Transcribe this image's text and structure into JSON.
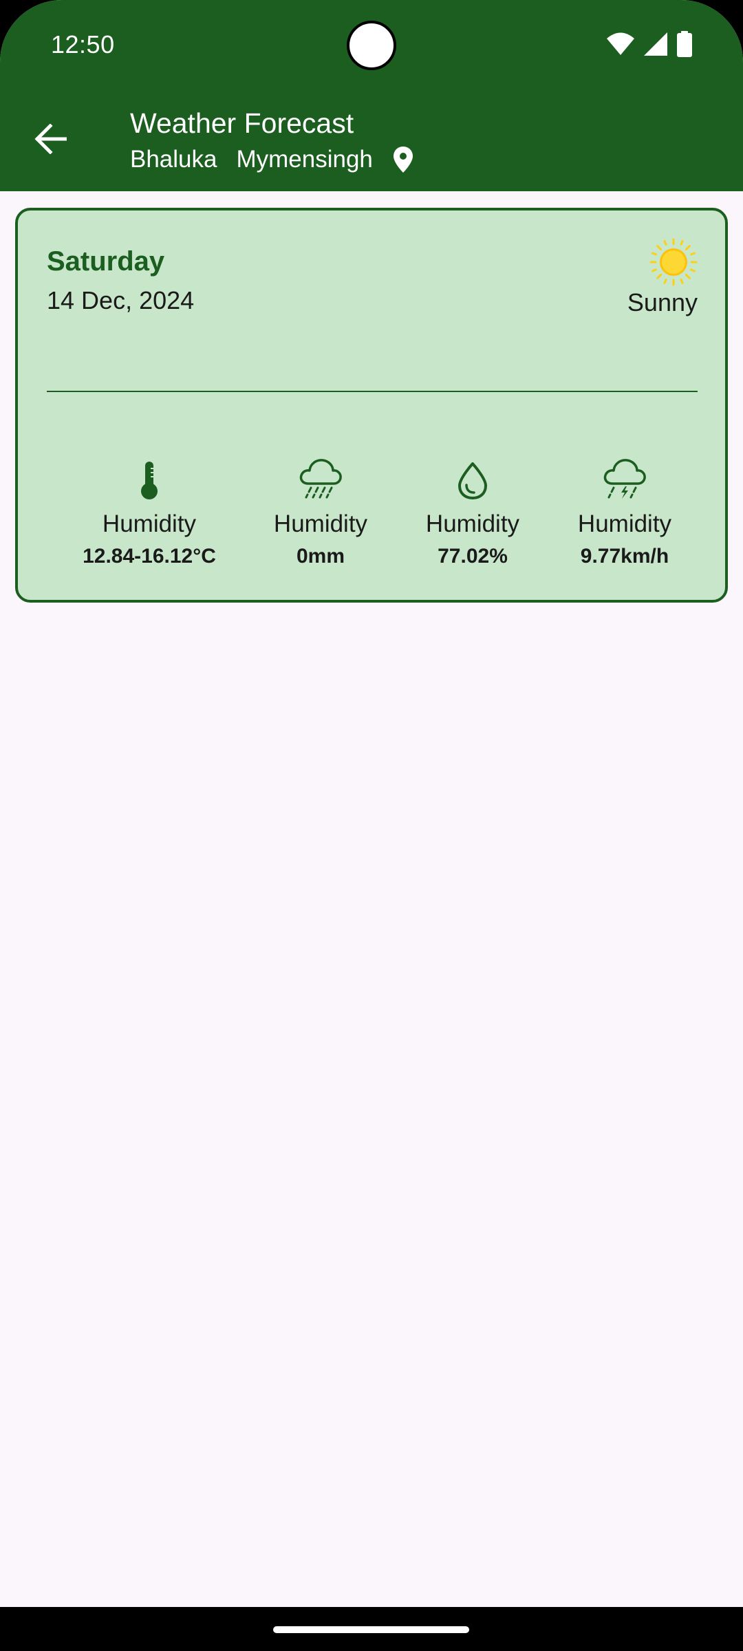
{
  "status_bar": {
    "time": "12:50",
    "icons": [
      "wifi-icon",
      "cellular-signal-icon",
      "battery-icon"
    ]
  },
  "toolbar": {
    "title": "Weather Forecast",
    "location_parts": [
      "Bhaluka",
      "Mymensingh"
    ],
    "location_icon": "location-pin-icon",
    "back_icon": "arrow-back-icon"
  },
  "forecast": {
    "day": "Saturday",
    "date": "14 Dec, 2024",
    "condition": "Sunny",
    "condition_icon": "sun-icon",
    "stats": [
      {
        "icon": "thermometer-icon",
        "label": "Humidity",
        "value": "12.84-16.12°C"
      },
      {
        "icon": "rain-cloud-icon",
        "label": "Humidity",
        "value": "0mm"
      },
      {
        "icon": "water-drop-icon",
        "label": "Humidity",
        "value": "77.02%"
      },
      {
        "icon": "storm-cloud-icon",
        "label": "Humidity",
        "value": "9.77km/h"
      }
    ]
  },
  "colors": {
    "primary": "#1b5e20",
    "card_background": "#c8e6c9",
    "page_background": "#fbf5fc",
    "sun": "#fdd017"
  }
}
